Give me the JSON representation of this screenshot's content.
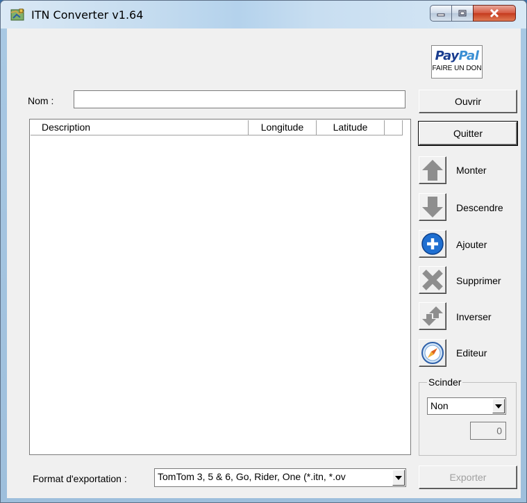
{
  "window": {
    "title": "ITN Converter v1.64"
  },
  "paypal": {
    "logo_a": "Pay",
    "logo_b": "Pal",
    "caption": "FAIRE UN DON"
  },
  "nom": {
    "label": "Nom :",
    "value": ""
  },
  "list": {
    "columns": [
      "Description",
      "Longitude",
      "Latitude"
    ],
    "rows": []
  },
  "buttons": {
    "ouvrir": "Ouvrir",
    "quitter": "Quitter",
    "monter": "Monter",
    "descendre": "Descendre",
    "ajouter": "Ajouter",
    "supprimer": "Supprimer",
    "inverser": "Inverser",
    "editeur": "Editeur",
    "exporter": "Exporter"
  },
  "scinder": {
    "label": "Scinder",
    "selected": "Non",
    "count": "0"
  },
  "format": {
    "label": "Format d'exportation :",
    "selected": "TomTom 3, 5 & 6, Go, Rider, One (*.itn, *.ov"
  },
  "colors": {
    "accent": "#1f6fd1",
    "window_bg": "#f0f0f0",
    "close_red": "#c53a1e"
  }
}
